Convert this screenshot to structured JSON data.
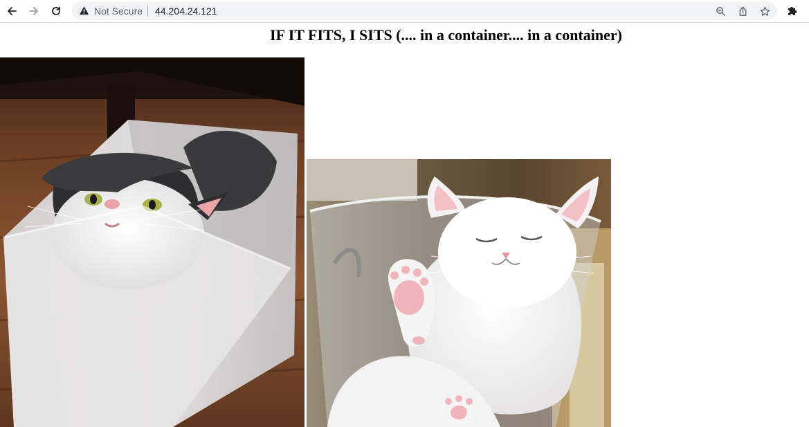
{
  "browser": {
    "security_label": "Not Secure",
    "url": "44.204.24.121"
  },
  "page": {
    "title": "IF IT FITS, I SITS (.... in a container.... in a container)"
  },
  "images": [
    {
      "subject": "gray-and-white kitten lying in a clear plastic box on a wooden floor"
    },
    {
      "subject": "white kitten sleeping in a glass bowl, paw raised"
    }
  ],
  "colors": {
    "omnibox_bg": "#f1f3f4",
    "icon": "#5f6368"
  },
  "icons": [
    "back-arrow-icon",
    "forward-arrow-icon",
    "reload-icon",
    "warning-icon",
    "zoom-icon",
    "share-icon",
    "star-icon",
    "extensions-puzzle-icon"
  ]
}
